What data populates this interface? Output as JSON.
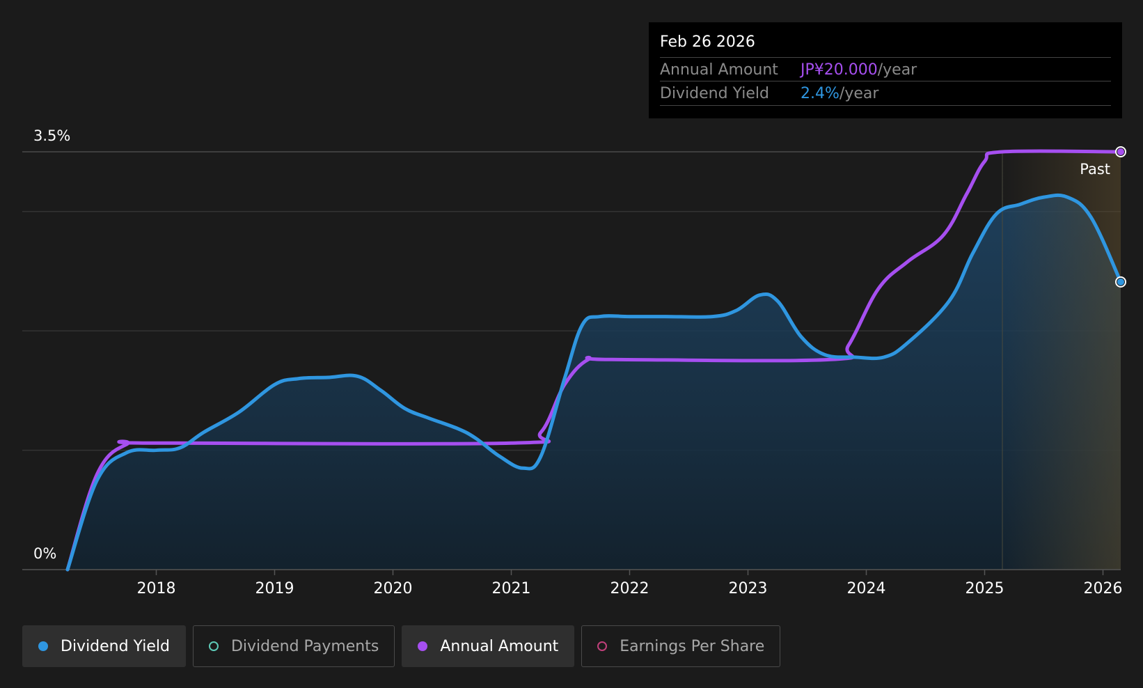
{
  "tooltip": {
    "date": "Feb 26 2026",
    "rows": [
      {
        "label": "Annual Amount",
        "value": "JP¥20.000",
        "unit": "/year",
        "color": "#a64ff0"
      },
      {
        "label": "Dividend Yield",
        "value": "2.4%",
        "unit": "/year",
        "color": "#2f96e0"
      }
    ]
  },
  "past_label": "Past",
  "legend": [
    {
      "label": "Dividend Yield",
      "color": "#2f96e0",
      "active": true,
      "icon": "filled-circle-icon"
    },
    {
      "label": "Dividend Payments",
      "color": "#5ecbb8",
      "active": false,
      "icon": "hollow-circle-icon"
    },
    {
      "label": "Annual Amount",
      "color": "#a64ff0",
      "active": true,
      "icon": "filled-circle-icon"
    },
    {
      "label": "Earnings Per Share",
      "color": "#c0407a",
      "active": false,
      "icon": "hollow-circle-icon"
    }
  ],
  "chart_data": {
    "type": "line",
    "y_tick_labels": [
      "0%",
      "3.5%"
    ],
    "ylim": [
      0,
      3.5
    ],
    "x_tick_labels": [
      "2018",
      "2019",
      "2020",
      "2021",
      "2022",
      "2023",
      "2024",
      "2025",
      "2026"
    ],
    "xlim": [
      2017.25,
      2026.15
    ],
    "past_region_start": 2025.15,
    "grid": true,
    "colors": {
      "yield": "#2f96e0",
      "annual": "#a64ff0"
    },
    "series": [
      {
        "name": "Dividend Yield",
        "key": "yield",
        "points": [
          [
            2017.25,
            0.0
          ],
          [
            2017.5,
            0.75
          ],
          [
            2017.75,
            0.98
          ],
          [
            2018.0,
            1.0
          ],
          [
            2018.2,
            1.02
          ],
          [
            2018.4,
            1.15
          ],
          [
            2018.7,
            1.32
          ],
          [
            2019.0,
            1.55
          ],
          [
            2019.2,
            1.6
          ],
          [
            2019.45,
            1.61
          ],
          [
            2019.7,
            1.62
          ],
          [
            2019.9,
            1.5
          ],
          [
            2020.1,
            1.35
          ],
          [
            2020.3,
            1.27
          ],
          [
            2020.55,
            1.18
          ],
          [
            2020.7,
            1.1
          ],
          [
            2020.9,
            0.95
          ],
          [
            2021.1,
            0.85
          ],
          [
            2021.25,
            0.95
          ],
          [
            2021.45,
            1.6
          ],
          [
            2021.6,
            2.05
          ],
          [
            2021.75,
            2.12
          ],
          [
            2022.0,
            2.12
          ],
          [
            2022.3,
            2.12
          ],
          [
            2022.7,
            2.12
          ],
          [
            2022.9,
            2.17
          ],
          [
            2023.1,
            2.3
          ],
          [
            2023.25,
            2.25
          ],
          [
            2023.45,
            1.95
          ],
          [
            2023.65,
            1.8
          ],
          [
            2023.9,
            1.78
          ],
          [
            2024.15,
            1.78
          ],
          [
            2024.35,
            1.9
          ],
          [
            2024.7,
            2.25
          ],
          [
            2024.9,
            2.65
          ],
          [
            2025.1,
            2.98
          ],
          [
            2025.3,
            3.06
          ],
          [
            2025.5,
            3.12
          ],
          [
            2025.7,
            3.12
          ],
          [
            2025.9,
            2.95
          ],
          [
            2026.15,
            2.41
          ]
        ]
      },
      {
        "name": "Annual Amount",
        "key": "annual",
        "points": [
          [
            2017.25,
            0.0
          ],
          [
            2017.5,
            0.8
          ],
          [
            2017.75,
            1.05
          ],
          [
            2018.0,
            1.06
          ],
          [
            2021.0,
            1.06
          ],
          [
            2021.25,
            1.15
          ],
          [
            2021.45,
            1.55
          ],
          [
            2021.65,
            1.76
          ],
          [
            2021.85,
            1.76
          ],
          [
            2023.7,
            1.76
          ],
          [
            2023.85,
            1.88
          ],
          [
            2024.1,
            2.35
          ],
          [
            2024.35,
            2.58
          ],
          [
            2024.65,
            2.8
          ],
          [
            2024.85,
            3.15
          ],
          [
            2025.0,
            3.42
          ],
          [
            2025.15,
            3.5
          ],
          [
            2026.15,
            3.5
          ]
        ]
      }
    ]
  }
}
